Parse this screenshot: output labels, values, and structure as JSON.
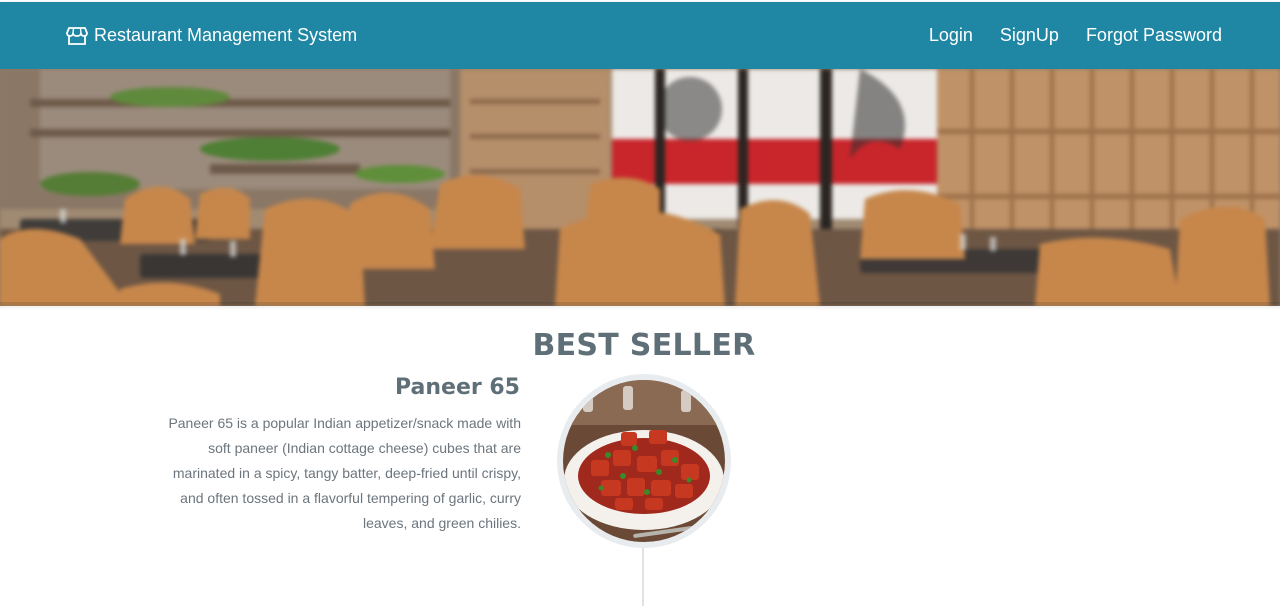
{
  "navbar": {
    "brand_icon": "store-icon",
    "brand_label": "Restaurant Management System",
    "links": [
      "Login",
      "SignUp",
      "Forgot Password"
    ],
    "background": "#1f86a3"
  },
  "best_seller": {
    "heading": "BEST SELLER",
    "item": {
      "name": "Paneer 65",
      "description": "Paneer 65 is a popular Indian appetizer/snack made with soft paneer (Indian cottage cheese) cubes that are marinated in a spicy, tangy batter, deep-fried until crispy, and often tossed in a flavorful tempering of garlic, curry leaves, and green chilies."
    }
  }
}
